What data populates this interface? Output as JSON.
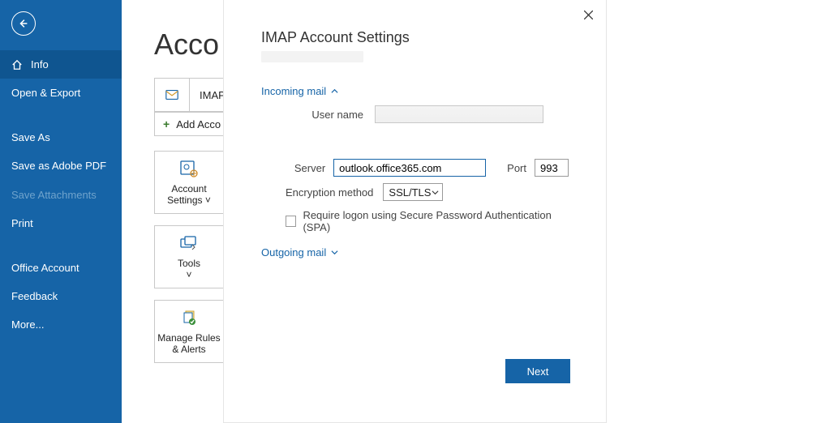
{
  "titlebar": {
    "help": "?"
  },
  "sidebar": {
    "items": [
      {
        "label": "Info",
        "selected": true,
        "icon": "home"
      },
      {
        "label": "Open & Export"
      },
      {
        "label": "Save As"
      },
      {
        "label": "Save as Adobe PDF"
      },
      {
        "label": "Save Attachments",
        "disabled": true
      },
      {
        "label": "Print"
      },
      {
        "label": "Office Account"
      },
      {
        "label": "Feedback"
      },
      {
        "label": "More..."
      }
    ]
  },
  "backstage": {
    "title_visible": "Acco",
    "account_type": "IMAP/",
    "add_account": "Add Acco",
    "tiles": [
      {
        "label": "Account Settings ˅"
      },
      {
        "label": "Tools\n˅"
      },
      {
        "label": "Manage Rules & Alerts"
      }
    ]
  },
  "dialog": {
    "title": "IMAP Account Settings",
    "incoming": {
      "header": "Incoming mail",
      "username_label": "User name",
      "username_value": "",
      "server_label": "Server",
      "server_value": "outlook.office365.com",
      "port_label": "Port",
      "port_value": "993",
      "enc_label": "Encryption method",
      "enc_value": "SSL/TLS",
      "spa_label": "Require logon using Secure Password Authentication (SPA)"
    },
    "outgoing": {
      "header": "Outgoing mail"
    },
    "next": "Next"
  }
}
